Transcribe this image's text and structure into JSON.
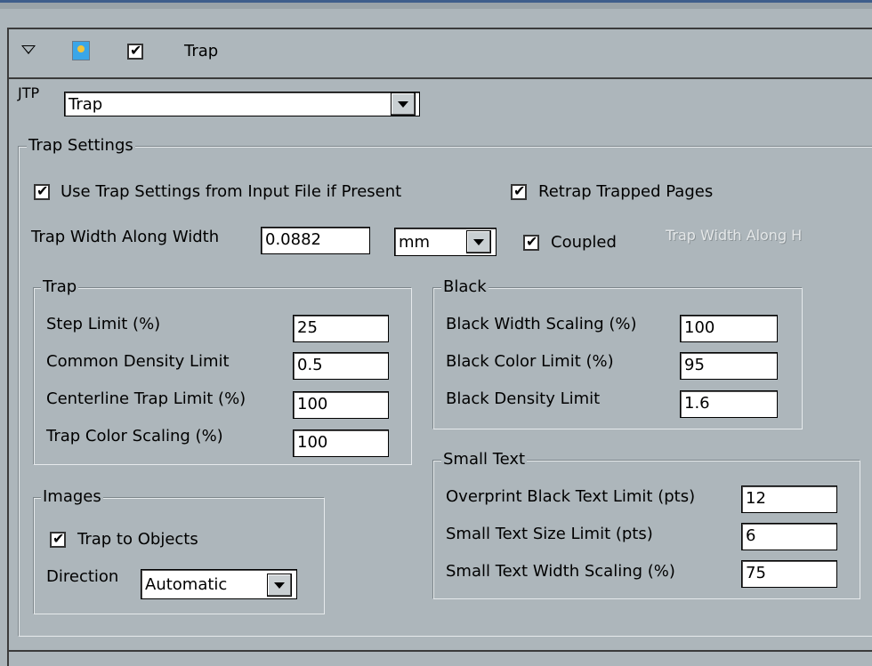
{
  "header": {
    "title": "Trap",
    "enabled_checked": true
  },
  "jtp": {
    "label": "JTP",
    "selected": "Trap"
  },
  "trap_settings": {
    "title": "Trap Settings",
    "use_input_settings": {
      "label": "Use Trap Settings from Input File if Present",
      "checked": true
    },
    "retrap": {
      "label": "Retrap Trapped Pages",
      "checked": true
    },
    "width_label": "Trap Width Along Width",
    "width_value": "0.0882",
    "unit": "mm",
    "coupled": {
      "label": "Coupled",
      "checked": true
    },
    "height_label": "Trap Width Along H"
  },
  "trap_group": {
    "title": "Trap",
    "fields": [
      {
        "label": "Step Limit (%)",
        "value": "25"
      },
      {
        "label": "Common Density Limit",
        "value": "0.5"
      },
      {
        "label": "Centerline Trap Limit (%)",
        "value": "100"
      },
      {
        "label": "Trap Color Scaling (%)",
        "value": "100"
      }
    ]
  },
  "black_group": {
    "title": "Black",
    "fields": [
      {
        "label": "Black Width Scaling (%)",
        "value": "100"
      },
      {
        "label": "Black Color Limit (%)",
        "value": "95"
      },
      {
        "label": "Black Density Limit",
        "value": "1.6"
      }
    ]
  },
  "small_text_group": {
    "title": "Small Text",
    "fields": [
      {
        "label": "Overprint Black Text Limit (pts)",
        "value": "12"
      },
      {
        "label": "Small Text Size Limit (pts)",
        "value": "6"
      },
      {
        "label": "Small Text Width Scaling (%)",
        "value": "75"
      }
    ]
  },
  "images_group": {
    "title": "Images",
    "trap_to_objects": {
      "label": "Trap to Objects",
      "checked": true
    },
    "direction_label": "Direction",
    "direction_value": "Automatic"
  }
}
